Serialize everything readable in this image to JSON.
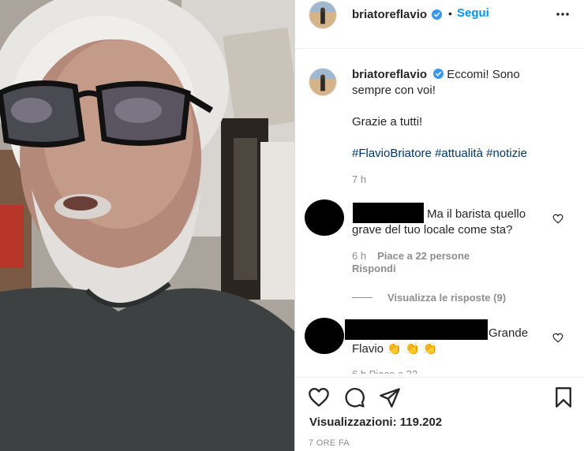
{
  "post": {
    "username": "briatoreflavio",
    "follow_label": "Segui",
    "dot": "•",
    "caption_line1": "Eccomi! Sono",
    "caption_line2": "sempre con voi!",
    "caption_thanks": "Grazie a tutti!",
    "hashtags": [
      "#FlavioBriatore",
      "#attualità",
      "#notizie"
    ],
    "time": "7 h"
  },
  "comments": [
    {
      "text_line1": "Ma il barista quello",
      "text_line2": "grave del tuo locale come sta?",
      "time": "6 h",
      "likes": "Piace a 22 persone",
      "reply": "Rispondi",
      "view_replies": "Visualizza le risposte (9)"
    },
    {
      "text_line1": "Grande",
      "text_line2": "Flavio 👏 👏 👏",
      "cutoff": "6 h    Piace a 22"
    }
  ],
  "footer": {
    "views": "Visualizzazioni: 119.202",
    "time_ago": "7 ORE FA"
  },
  "colors": {
    "accent": "#0095f6",
    "hashtag": "#00376b",
    "secondary": "#8e8e8e",
    "verified": "#3897f0"
  },
  "icons": [
    "verified-icon",
    "more-options-icon",
    "heart-icon",
    "comment-icon",
    "share-icon",
    "bookmark-icon"
  ]
}
